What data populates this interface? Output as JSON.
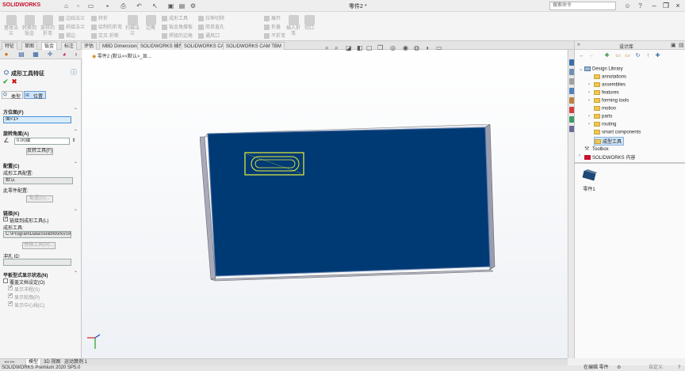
{
  "app": {
    "logo_text": "SOLIDWORKS",
    "doc_title": "零件2 *",
    "search_placeholder": "搜索命令"
  },
  "ribbon": {
    "small_buttons": [
      "边线法兰",
      "斜接法兰",
      "褶边",
      "转折",
      "绘制的折弯",
      "交叉-折断",
      "成形工具",
      "钣金角撑板",
      "焊接的边角",
      "拉伸切除",
      "简单直孔",
      "通风口",
      "展开",
      "折叠",
      "不折弯"
    ],
    "large_buttons": [
      "基体法兰",
      "转换到钣金",
      "放样的折弯",
      "扫描法兰",
      "边角",
      "插入折弯",
      "切口"
    ]
  },
  "tabs": {
    "items": [
      "特征",
      "草图",
      "钣金",
      "标注",
      "评估",
      "MBD Dimensions",
      "SOLIDWORKS 插件",
      "SOLIDWORKS CAM",
      "SOLIDWORKS CAM TBM"
    ],
    "active_index": 2
  },
  "property_manager": {
    "title": "成形工具特征",
    "tab_type": "类型",
    "tab_position": "位置",
    "section_face": "方位面(F)",
    "face_value": "面<1>",
    "section_angle": "旋转角度(A)",
    "angle_value": "0.00度",
    "flip_tool_button": "反转工具(F)",
    "section_config": "配置(C)",
    "tool_config_label": "成形工具配置:",
    "tool_config_value": "默认",
    "part_config_label": "此零件配置:",
    "config_button": "配置(U)...",
    "section_link": "链接(K)",
    "link_checkbox": "链接到成形工具(L)",
    "forming_tool_label": "成形工具:",
    "forming_tool_path": "C:\\ProgramData\\SolidWorks\\SOLIDW",
    "replace_tool_button": "替换工具(R)...",
    "punch_id_label": "冲孔 ID:",
    "section_flat": "平板型式显示状态(N)",
    "override_doc": "覆盖文档设定(O)",
    "show_punch": "显示冲程(S)",
    "show_outline": "显示轮廓(P)",
    "show_center": "显示中心线(C)"
  },
  "viewport": {
    "breadcrumb": "零件2 (默认<<默认>_显..."
  },
  "design_library": {
    "title": "设计库",
    "items": [
      {
        "label": "Design Library",
        "indent": 0
      },
      {
        "label": "annotations",
        "indent": 1
      },
      {
        "label": "assemblies",
        "indent": 1
      },
      {
        "label": "features",
        "indent": 1
      },
      {
        "label": "forming tools",
        "indent": 1
      },
      {
        "label": "motion",
        "indent": 1
      },
      {
        "label": "parts",
        "indent": 1
      },
      {
        "label": "routing",
        "indent": 1
      },
      {
        "label": "smart components",
        "indent": 1
      },
      {
        "label": "成型工具",
        "indent": 1,
        "selected": true
      },
      {
        "label": "Toolbox",
        "indent": 0
      },
      {
        "label": "SOLIDWORKS 内容",
        "indent": 0
      }
    ],
    "preview_label": "零件1"
  },
  "bottom_tabs": [
    "模型",
    "3D 视图",
    "运动算例 1"
  ],
  "bottom_active": 0,
  "status": {
    "version": "SOLIDWORKS Premium 2020 SP5.0",
    "editing": "在编辑 零件",
    "units": "自定义"
  },
  "colors": {
    "plate_face": "#003a75",
    "tool_highlight": "#e8f23c",
    "accent": "#c8102e"
  }
}
